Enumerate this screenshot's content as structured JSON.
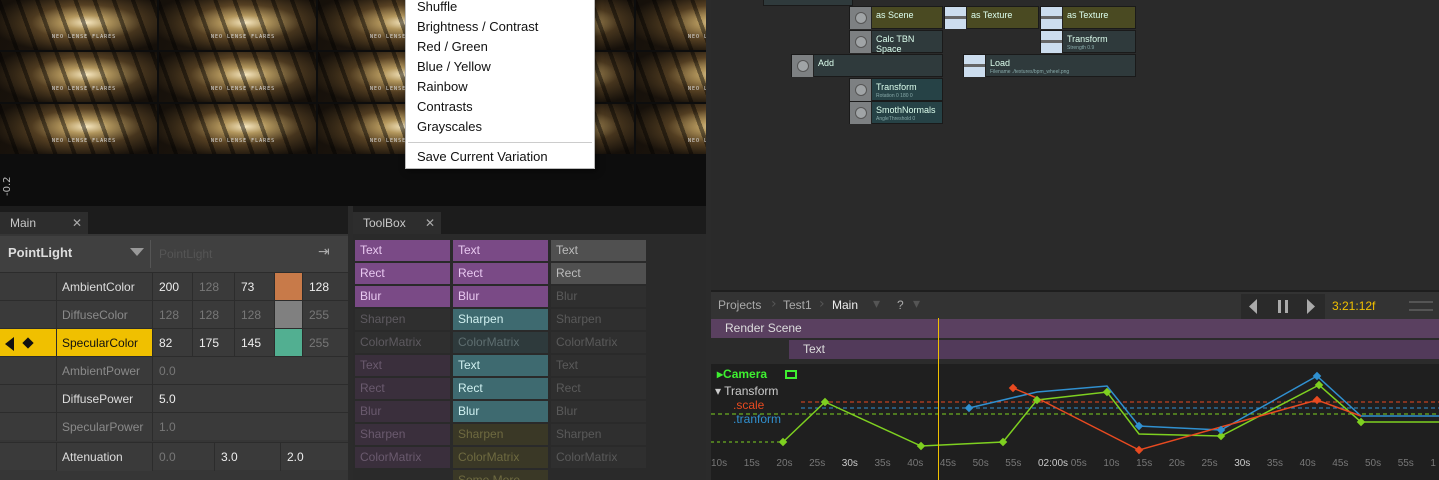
{
  "viewer": {
    "thumb_label": "NEO LENSE FLARES",
    "axis_value": "-0.2"
  },
  "context_menu": {
    "items": [
      "Shuffle",
      "Brightness / Contrast",
      "Red / Green",
      "Blue / Yellow",
      "Rainbow",
      "Contrasts",
      "Grayscales"
    ],
    "save_item": "Save Current Variation"
  },
  "graph": {
    "nodes": {
      "as_scene": "as Scene",
      "as_texture_1": "as Texture",
      "as_texture_2": "as Texture",
      "calc_tbn": "Calc TBN Space",
      "transform_top": "Transform",
      "transform_top_sub": "Strength 0.9",
      "add": "Add",
      "load": "Load",
      "load_sub": "Filename ./textures/bpm_wheel.png",
      "transform": "Transform",
      "transform_sub": "Rotation 0 180 0",
      "smooth": "SmothNormals",
      "smooth_sub": "AngleThreshold 0"
    }
  },
  "main_panel": {
    "tab_label": "Main",
    "close": "✕",
    "op_title": "PointLight",
    "op_name": "PointLight",
    "rows": [
      {
        "label": "AmbientColor",
        "values": [
          "200",
          "128",
          "73",
          "",
          "128"
        ]
      },
      {
        "label": "DiffuseColor",
        "values": [
          "128",
          "128",
          "128",
          "",
          "255"
        ]
      },
      {
        "label": "SpecularColor",
        "values": [
          "82",
          "175",
          "145",
          "",
          "255"
        ]
      },
      {
        "label": "AmbientPower",
        "values": [
          "0.0"
        ]
      },
      {
        "label": "DiffusePower",
        "values": [
          "5.0"
        ]
      },
      {
        "label": "SpecularPower",
        "values": [
          "1.0"
        ]
      },
      {
        "label": "Attenuation",
        "values": [
          "0.0",
          "3.0",
          "2.0"
        ]
      }
    ],
    "colors": {
      "ambient_swatch": "#c87a49",
      "diffuse_swatch": "#808080",
      "specular_swatch": "#52af91",
      "highlight": "#f0c000"
    }
  },
  "toolbox": {
    "tab_label": "ToolBox",
    "close": "✕",
    "col1": [
      "Text",
      "Rect",
      "Blur",
      "Sharpen",
      "ColorMatrix",
      "Text",
      "Rect",
      "Blur",
      "Sharpen",
      "ColorMatrix"
    ],
    "col2": [
      "Text",
      "Rect",
      "Blur",
      "Sharpen",
      "ColorMatrix",
      "Text",
      "Rect",
      "Blur",
      "Sharpen",
      "ColorMatrix",
      "Some More"
    ],
    "col3": [
      "Text",
      "Rect",
      "Blur",
      "Sharpen",
      "ColorMatrix",
      "Text",
      "Rect",
      "Blur",
      "Sharpen",
      "ColorMatrix"
    ]
  },
  "timeline": {
    "breadcrumbs": [
      "Projects",
      "Test1",
      "Main",
      "?"
    ],
    "time": "3:21:12f",
    "tracks": [
      "Render Scene",
      "Text"
    ],
    "curve_labels": {
      "camera": "Camera",
      "transform": "Transform",
      "scale": ".scale",
      "tranform": ".tranform"
    },
    "ruler": [
      "10s",
      "15s",
      "20s",
      "25s",
      "30s",
      "35s",
      "40s",
      "45s",
      "50s",
      "55s",
      "02:00s",
      "05s",
      "10s",
      "15s",
      "20s",
      "25s",
      "30s",
      "35s",
      "40s",
      "45s",
      "50s",
      "55s",
      "1"
    ],
    "colors": {
      "camera": "#3ef030",
      "scale": "#e84a20",
      "tranform": "#3090d0",
      "green": "#7ed020",
      "playhead": "#f0c000"
    }
  }
}
